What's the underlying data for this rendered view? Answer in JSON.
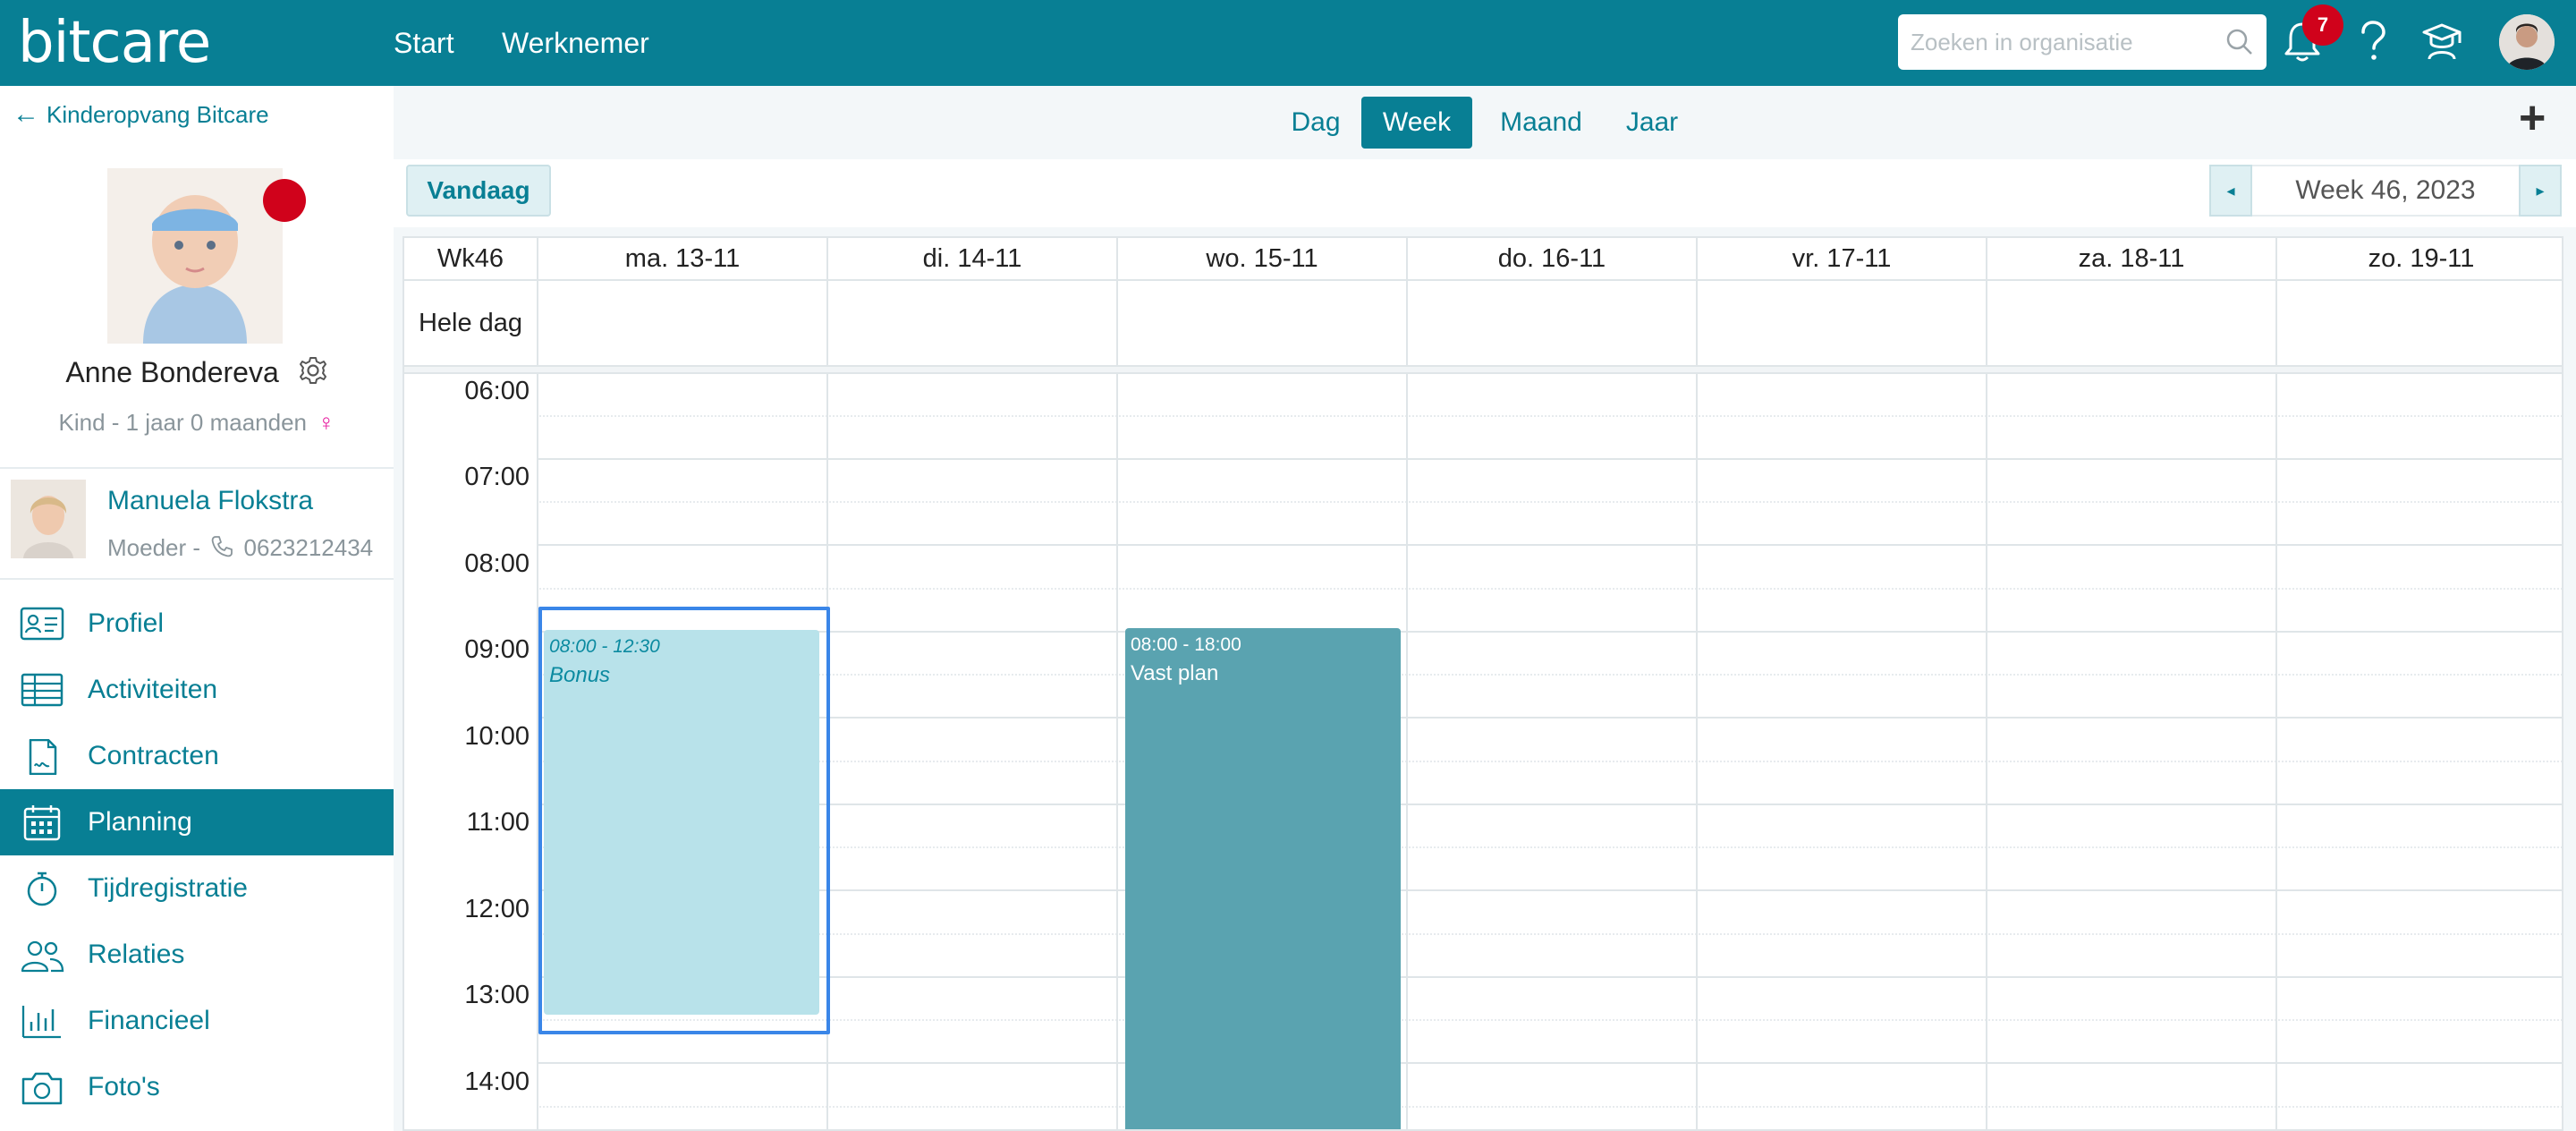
{
  "app": {
    "logo": "bitcare",
    "nav": [
      "Start",
      "Werknemer"
    ]
  },
  "search": {
    "placeholder": "Zoeken in organisatie"
  },
  "notifications": {
    "count": "7"
  },
  "topbar_icons": [
    "search-icon",
    "bell-icon",
    "help-icon",
    "graduation-cap-icon",
    "user-avatar"
  ],
  "sidebar": {
    "back_label": "Kinderopvang Bitcare",
    "child": {
      "name": "Anne Bondereva",
      "subtitle": "Kind - 1 jaar 0 maanden",
      "gender_symbol": "♀",
      "status_color": "#d0021b"
    },
    "parent": {
      "name": "Manuela Flokstra",
      "role": "Moeder -",
      "phone": "0623212434"
    },
    "items": [
      {
        "label": "Profiel",
        "icon": "id-card-icon",
        "active": false
      },
      {
        "label": "Activiteiten",
        "icon": "table-icon",
        "active": false
      },
      {
        "label": "Contracten",
        "icon": "contract-document-icon",
        "active": false
      },
      {
        "label": "Planning",
        "icon": "calendar-icon",
        "active": true
      },
      {
        "label": "Tijdregistratie",
        "icon": "stopwatch-icon",
        "active": false
      },
      {
        "label": "Relaties",
        "icon": "people-icon",
        "active": false
      },
      {
        "label": "Financieel",
        "icon": "bar-chart-icon",
        "active": false
      },
      {
        "label": "Foto's",
        "icon": "camera-icon",
        "active": false
      }
    ]
  },
  "views": {
    "tabs": [
      "Dag",
      "Week",
      "Maand",
      "Jaar"
    ],
    "active": "Week",
    "add_label": "+"
  },
  "toolbar": {
    "today_label": "Vandaag",
    "week_label": "Week 46, 2023",
    "prev_symbol": "◂",
    "next_symbol": "▸"
  },
  "calendar": {
    "week_label": "Wk46",
    "allday_label": "Hele dag",
    "days": [
      "ma. 13-11",
      "di. 14-11",
      "wo. 15-11",
      "do. 16-11",
      "vr. 17-11",
      "za. 18-11",
      "zo. 19-11"
    ],
    "hours": [
      "06:00",
      "07:00",
      "08:00",
      "09:00",
      "10:00",
      "11:00",
      "12:00",
      "13:00",
      "14:00"
    ],
    "events": [
      {
        "day": "ma. 13-11",
        "time": "08:00 - 12:30",
        "title": "Bonus",
        "kind": "bonus",
        "selected": true
      },
      {
        "day": "wo. 15-11",
        "time": "08:00 - 18:00",
        "title": "Vast plan",
        "kind": "vast",
        "selected": false
      }
    ]
  },
  "colors": {
    "brand": "#087f94",
    "bonus_event": "#b8e2ea",
    "vast_event": "#5aa3b0",
    "selection": "#3a86e8",
    "badge": "#d0021b"
  }
}
